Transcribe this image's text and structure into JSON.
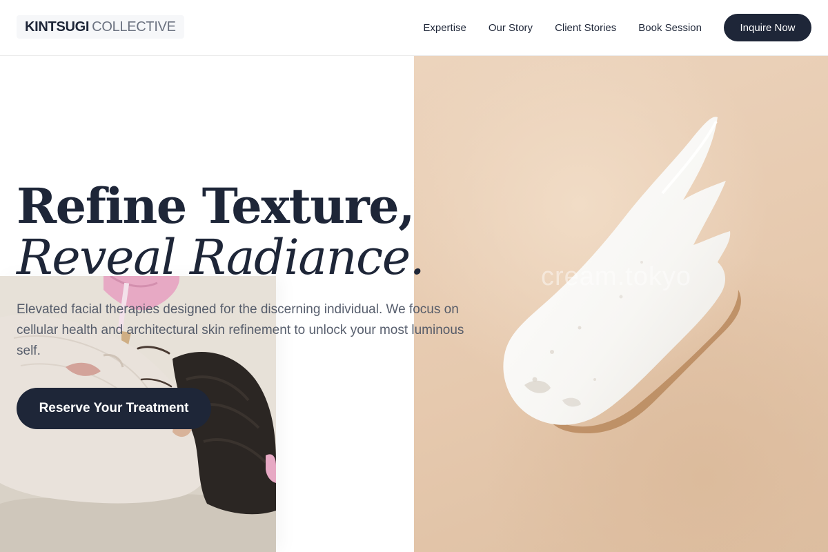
{
  "brand": {
    "name_strong": "KINTSUGI",
    "name_light": "COLLECTIVE"
  },
  "nav": {
    "items": [
      {
        "label": "Expertise"
      },
      {
        "label": "Our Story"
      },
      {
        "label": "Client Stories"
      },
      {
        "label": "Book Session"
      }
    ],
    "cta_label": "Inquire Now"
  },
  "hero": {
    "headline_line1": "Refine Texture,",
    "headline_line2": "Reveal Radiance.",
    "description": "Elevated facial therapies designed for the discerning individual. We focus on cellular health and architectural skin refinement to unlock your most luminous self.",
    "cta_label": "Reserve Your Treatment",
    "image_watermark": "cream.tokyo"
  },
  "colors": {
    "primary_navy": "#1e2638",
    "text_muted": "#4a5262",
    "cream_background": "#e8cdb3",
    "white": "#ffffff"
  }
}
